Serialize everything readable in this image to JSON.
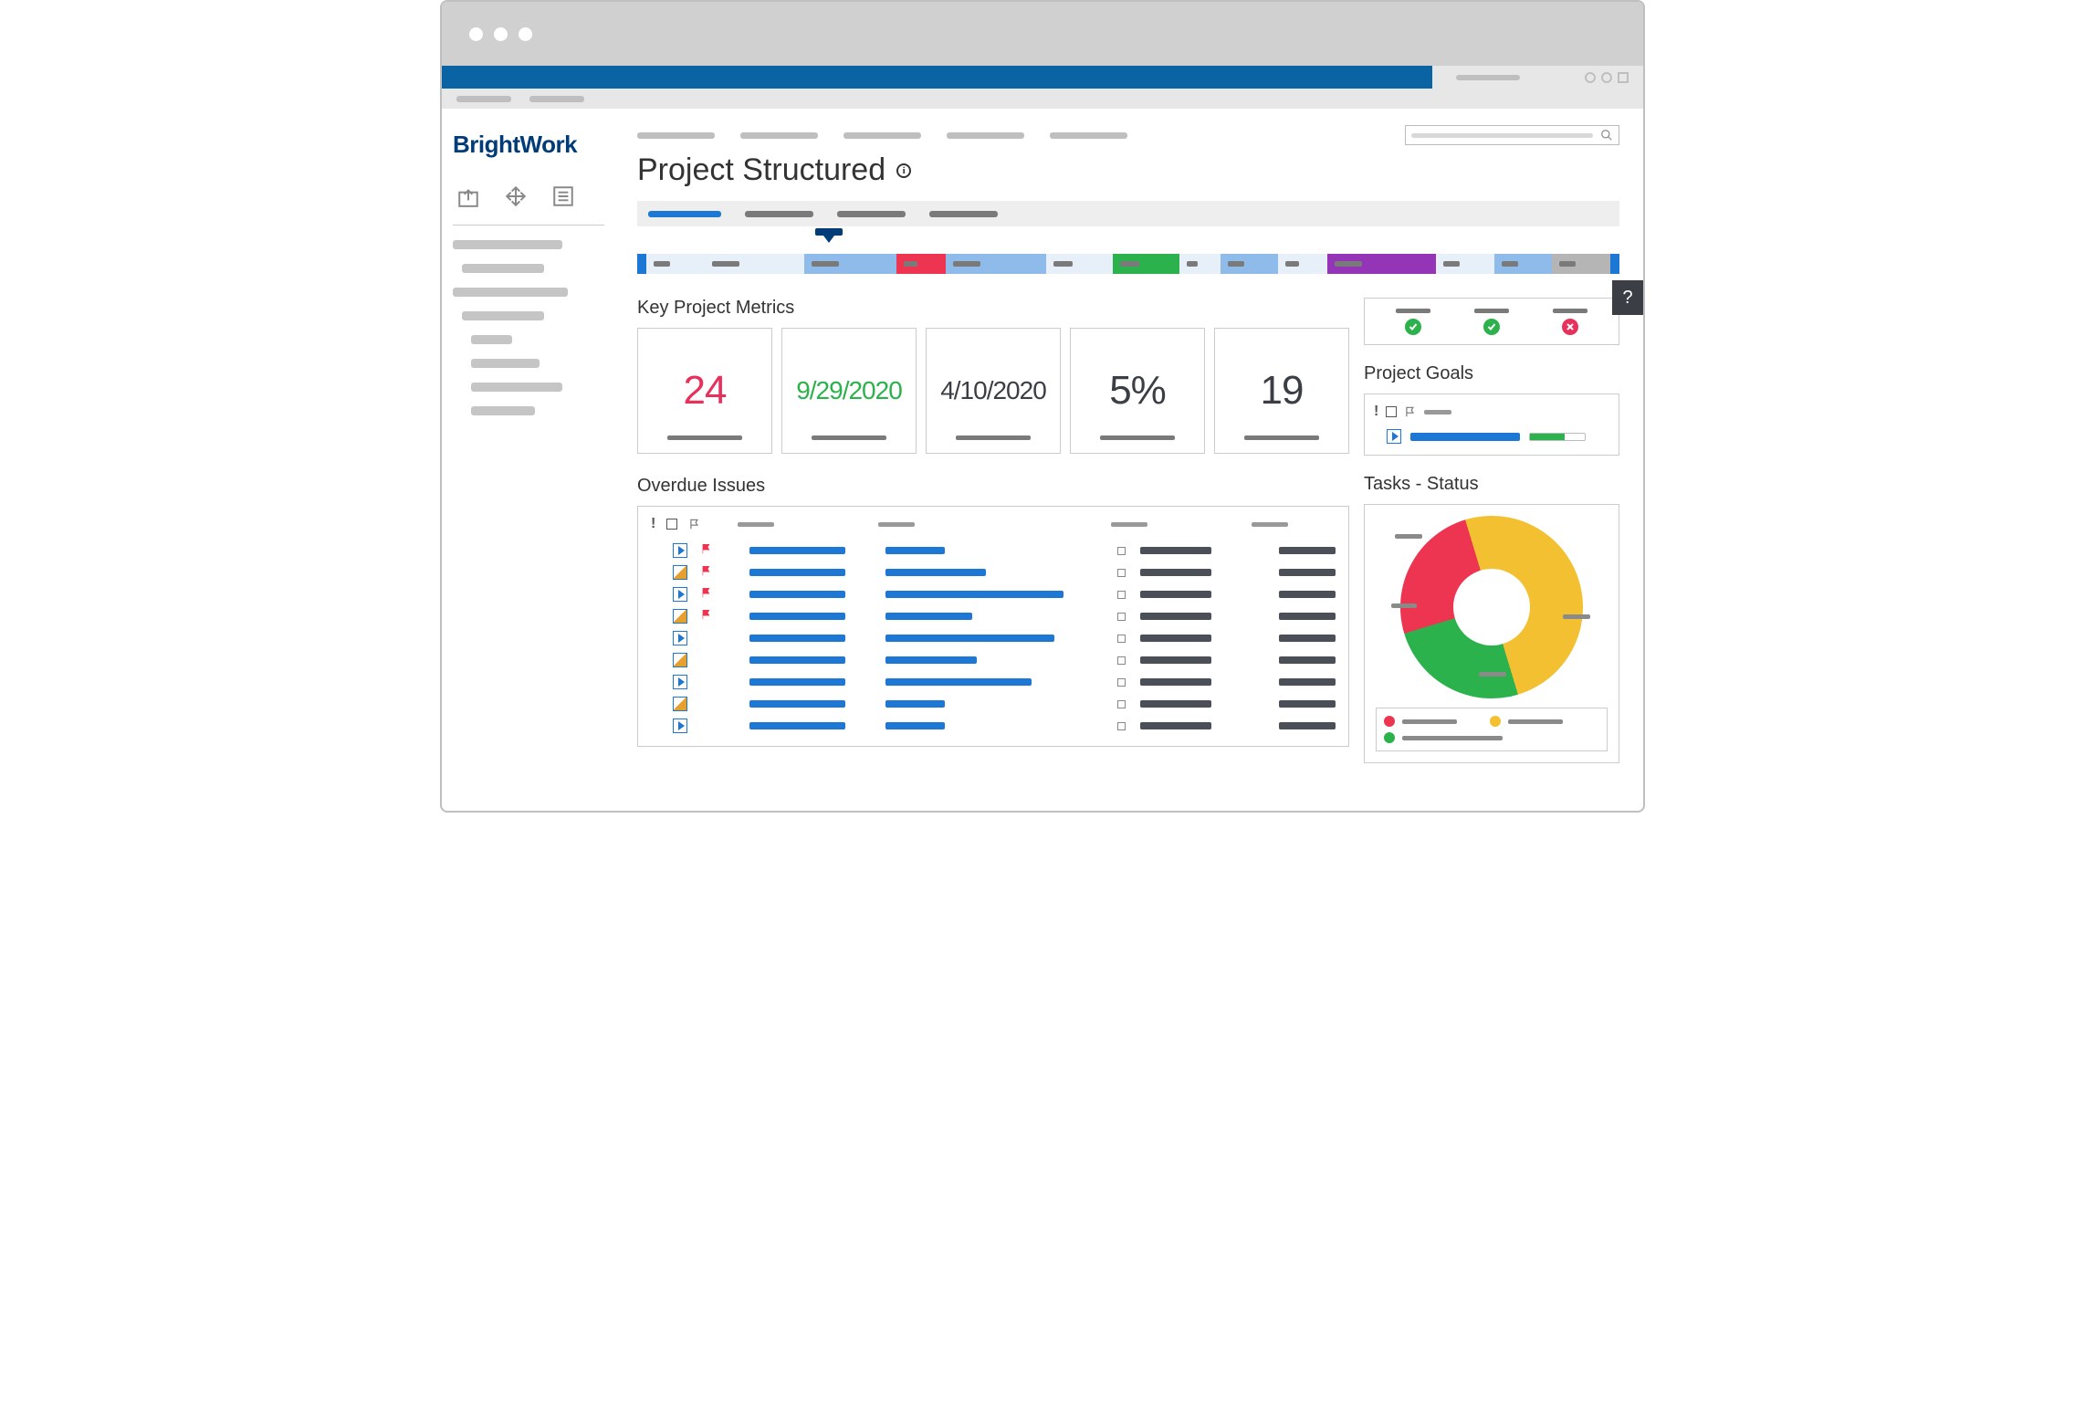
{
  "logo": "BrightWork",
  "page_title": "Project Structured",
  "sections": {
    "metrics_title": "Key Project Metrics",
    "issues_title": "Overdue Issues",
    "goals_title": "Project Goals",
    "tasks_title": "Tasks - Status"
  },
  "help_label": "?",
  "metrics": [
    {
      "value": "24",
      "color": "red"
    },
    {
      "value": "9/29/2020",
      "color": "green",
      "size": "28px"
    },
    {
      "value": "4/10/2020",
      "color": "gray",
      "size": "28px"
    },
    {
      "value": "5%",
      "color": "gray"
    },
    {
      "value": "19",
      "color": "gray"
    }
  ],
  "timeline": [
    {
      "w": 6,
      "bg": "#e7eff9"
    },
    {
      "w": 11,
      "bg": "#e7eff9"
    },
    {
      "w": 10,
      "bg": "#8fbbea"
    },
    {
      "w": 5,
      "bg": "#ed3552"
    },
    {
      "w": 11,
      "bg": "#8fbbea"
    },
    {
      "w": 7,
      "bg": "#e7eff9"
    },
    {
      "w": 7,
      "bg": "#2bb24c"
    },
    {
      "w": 4,
      "bg": "#e7eff9"
    },
    {
      "w": 6,
      "bg": "#8fbbea"
    },
    {
      "w": 5,
      "bg": "#e7eff9"
    },
    {
      "w": 12,
      "bg": "#9435b8"
    },
    {
      "w": 6,
      "bg": "#e7eff9"
    },
    {
      "w": 6,
      "bg": "#8fbbea"
    },
    {
      "w": 6,
      "bg": "#b5b5b5"
    }
  ],
  "status_summary": [
    {
      "state": "ok"
    },
    {
      "state": "ok"
    },
    {
      "state": "bad"
    }
  ],
  "goals": [
    {
      "type": "play",
      "bar1_w": 120,
      "bar1_c": "#1d77d4",
      "bar2_w": 62,
      "bar2_fill": 38,
      "bar2_c": "#2bb24c"
    }
  ],
  "issues": [
    {
      "type": "play",
      "flag": true,
      "c1": 105,
      "c2": 65,
      "c3": 78,
      "c4": 62
    },
    {
      "type": "edit",
      "flag": true,
      "c1": 105,
      "c2": 110,
      "c3": 78,
      "c4": 62
    },
    {
      "type": "play",
      "flag": true,
      "c1": 105,
      "c2": 195,
      "c3": 78,
      "c4": 62
    },
    {
      "type": "edit",
      "flag": true,
      "c1": 105,
      "c2": 95,
      "c3": 78,
      "c4": 62
    },
    {
      "type": "play",
      "flag": false,
      "c1": 105,
      "c2": 185,
      "c3": 78,
      "c4": 62
    },
    {
      "type": "edit",
      "flag": false,
      "c1": 105,
      "c2": 100,
      "c3": 78,
      "c4": 62
    },
    {
      "type": "play",
      "flag": false,
      "c1": 105,
      "c2": 160,
      "c3": 78,
      "c4": 62
    },
    {
      "type": "edit",
      "flag": false,
      "c1": 105,
      "c2": 65,
      "c3": 78,
      "c4": 62
    },
    {
      "type": "play",
      "flag": false,
      "c1": 105,
      "c2": 65,
      "c3": 78,
      "c4": 62
    }
  ],
  "chart_data": {
    "type": "pie",
    "title": "Tasks - Status",
    "series": [
      {
        "name": "",
        "color": "#ed3552",
        "value": 12
      },
      {
        "name": "",
        "color": "#f2c030",
        "value": 50
      },
      {
        "name": "",
        "color": "#2bb24c",
        "value": 25
      },
      {
        "name": "",
        "color": "#ed3552",
        "value": 13
      }
    ]
  }
}
